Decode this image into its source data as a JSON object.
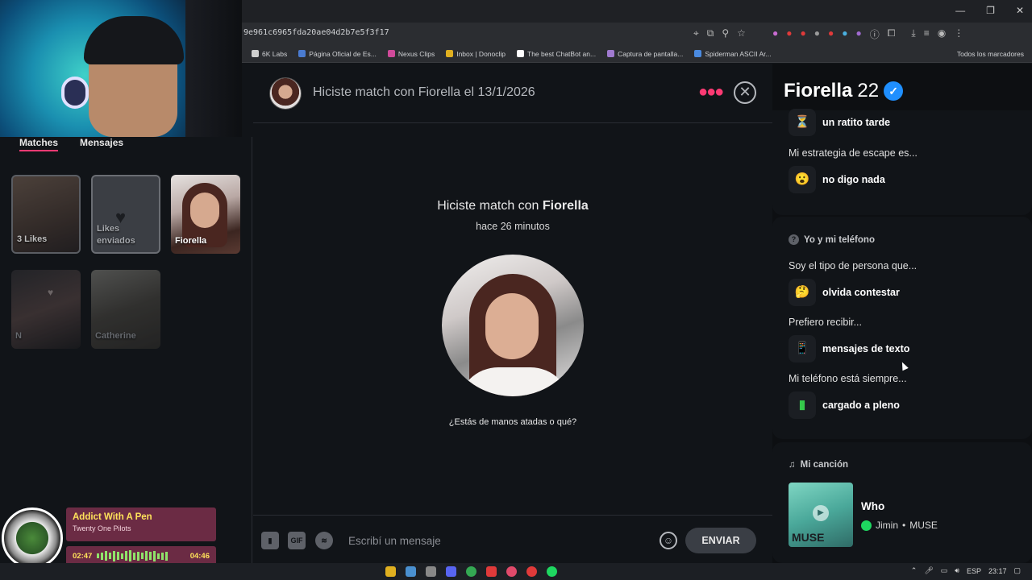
{
  "browser": {
    "url": "9e961c6965fda20ae04d2b7e5f3f17",
    "bookmarks": [
      {
        "label": "6K Labs",
        "color": "#cfcfcf"
      },
      {
        "label": "Página Oficial de Es...",
        "color": "#4a7bd0"
      },
      {
        "label": "Nexus Clips",
        "color": "#d04a9a"
      },
      {
        "label": "Inbox | Donoclip",
        "color": "#e0b020"
      },
      {
        "label": "The best ChatBot an...",
        "color": "#ffffff"
      },
      {
        "label": "Captura de pantalla...",
        "color": "#a07ad0"
      },
      {
        "label": "Spiderman ASCII Ar...",
        "color": "#4a8ae0"
      }
    ],
    "all_bookmarks": "Todos los marcadores"
  },
  "sidebar": {
    "tab_matches": "Matches",
    "tab_messages": "Mensajes",
    "cards": {
      "likes": "3 Likes",
      "likes_sent": "Likes enviados",
      "fiorella": "Fiorella",
      "n": "N",
      "catherine": "Catherine"
    }
  },
  "music": {
    "title": "Addict With A Pen",
    "artist": "Twenty One Pilots",
    "elapsed": "02:47",
    "total": "04:46",
    "progress": 0.59
  },
  "chat": {
    "header_text": "Hiciste match con Fiorella el 13/1/2026",
    "match_prefix": "Hiciste match con",
    "match_name": "Fiorella",
    "match_time": "hace 26 minutos",
    "opener": "¿Estás de manos atadas o qué?",
    "input_placeholder": "Escribí un mensaje",
    "gif_label": "GIF",
    "send_label": "ENVIAR"
  },
  "profile": {
    "name": "Fiorella",
    "age": "22",
    "prompt1_answer": "un ratito tarde",
    "prompt2_question": "Mi estrategia de escape es...",
    "prompt2_answer": "no digo nada",
    "section_phone_title": "Yo y mi teléfono",
    "phone_q1": "Soy el tipo de persona que...",
    "phone_a1": "olvida contestar",
    "phone_q2": "Prefiero recibir...",
    "phone_a2": "mensajes de texto",
    "phone_q3": "Mi teléfono está siempre...",
    "phone_a3": "cargado a pleno",
    "song_section_title": "Mi canción",
    "song_title": "Who",
    "song_artist": "Jimin",
    "song_album": "MUSE",
    "song_art_text": "MUSE"
  },
  "taskbar": {
    "lang": "ESP",
    "time": "23:17"
  }
}
